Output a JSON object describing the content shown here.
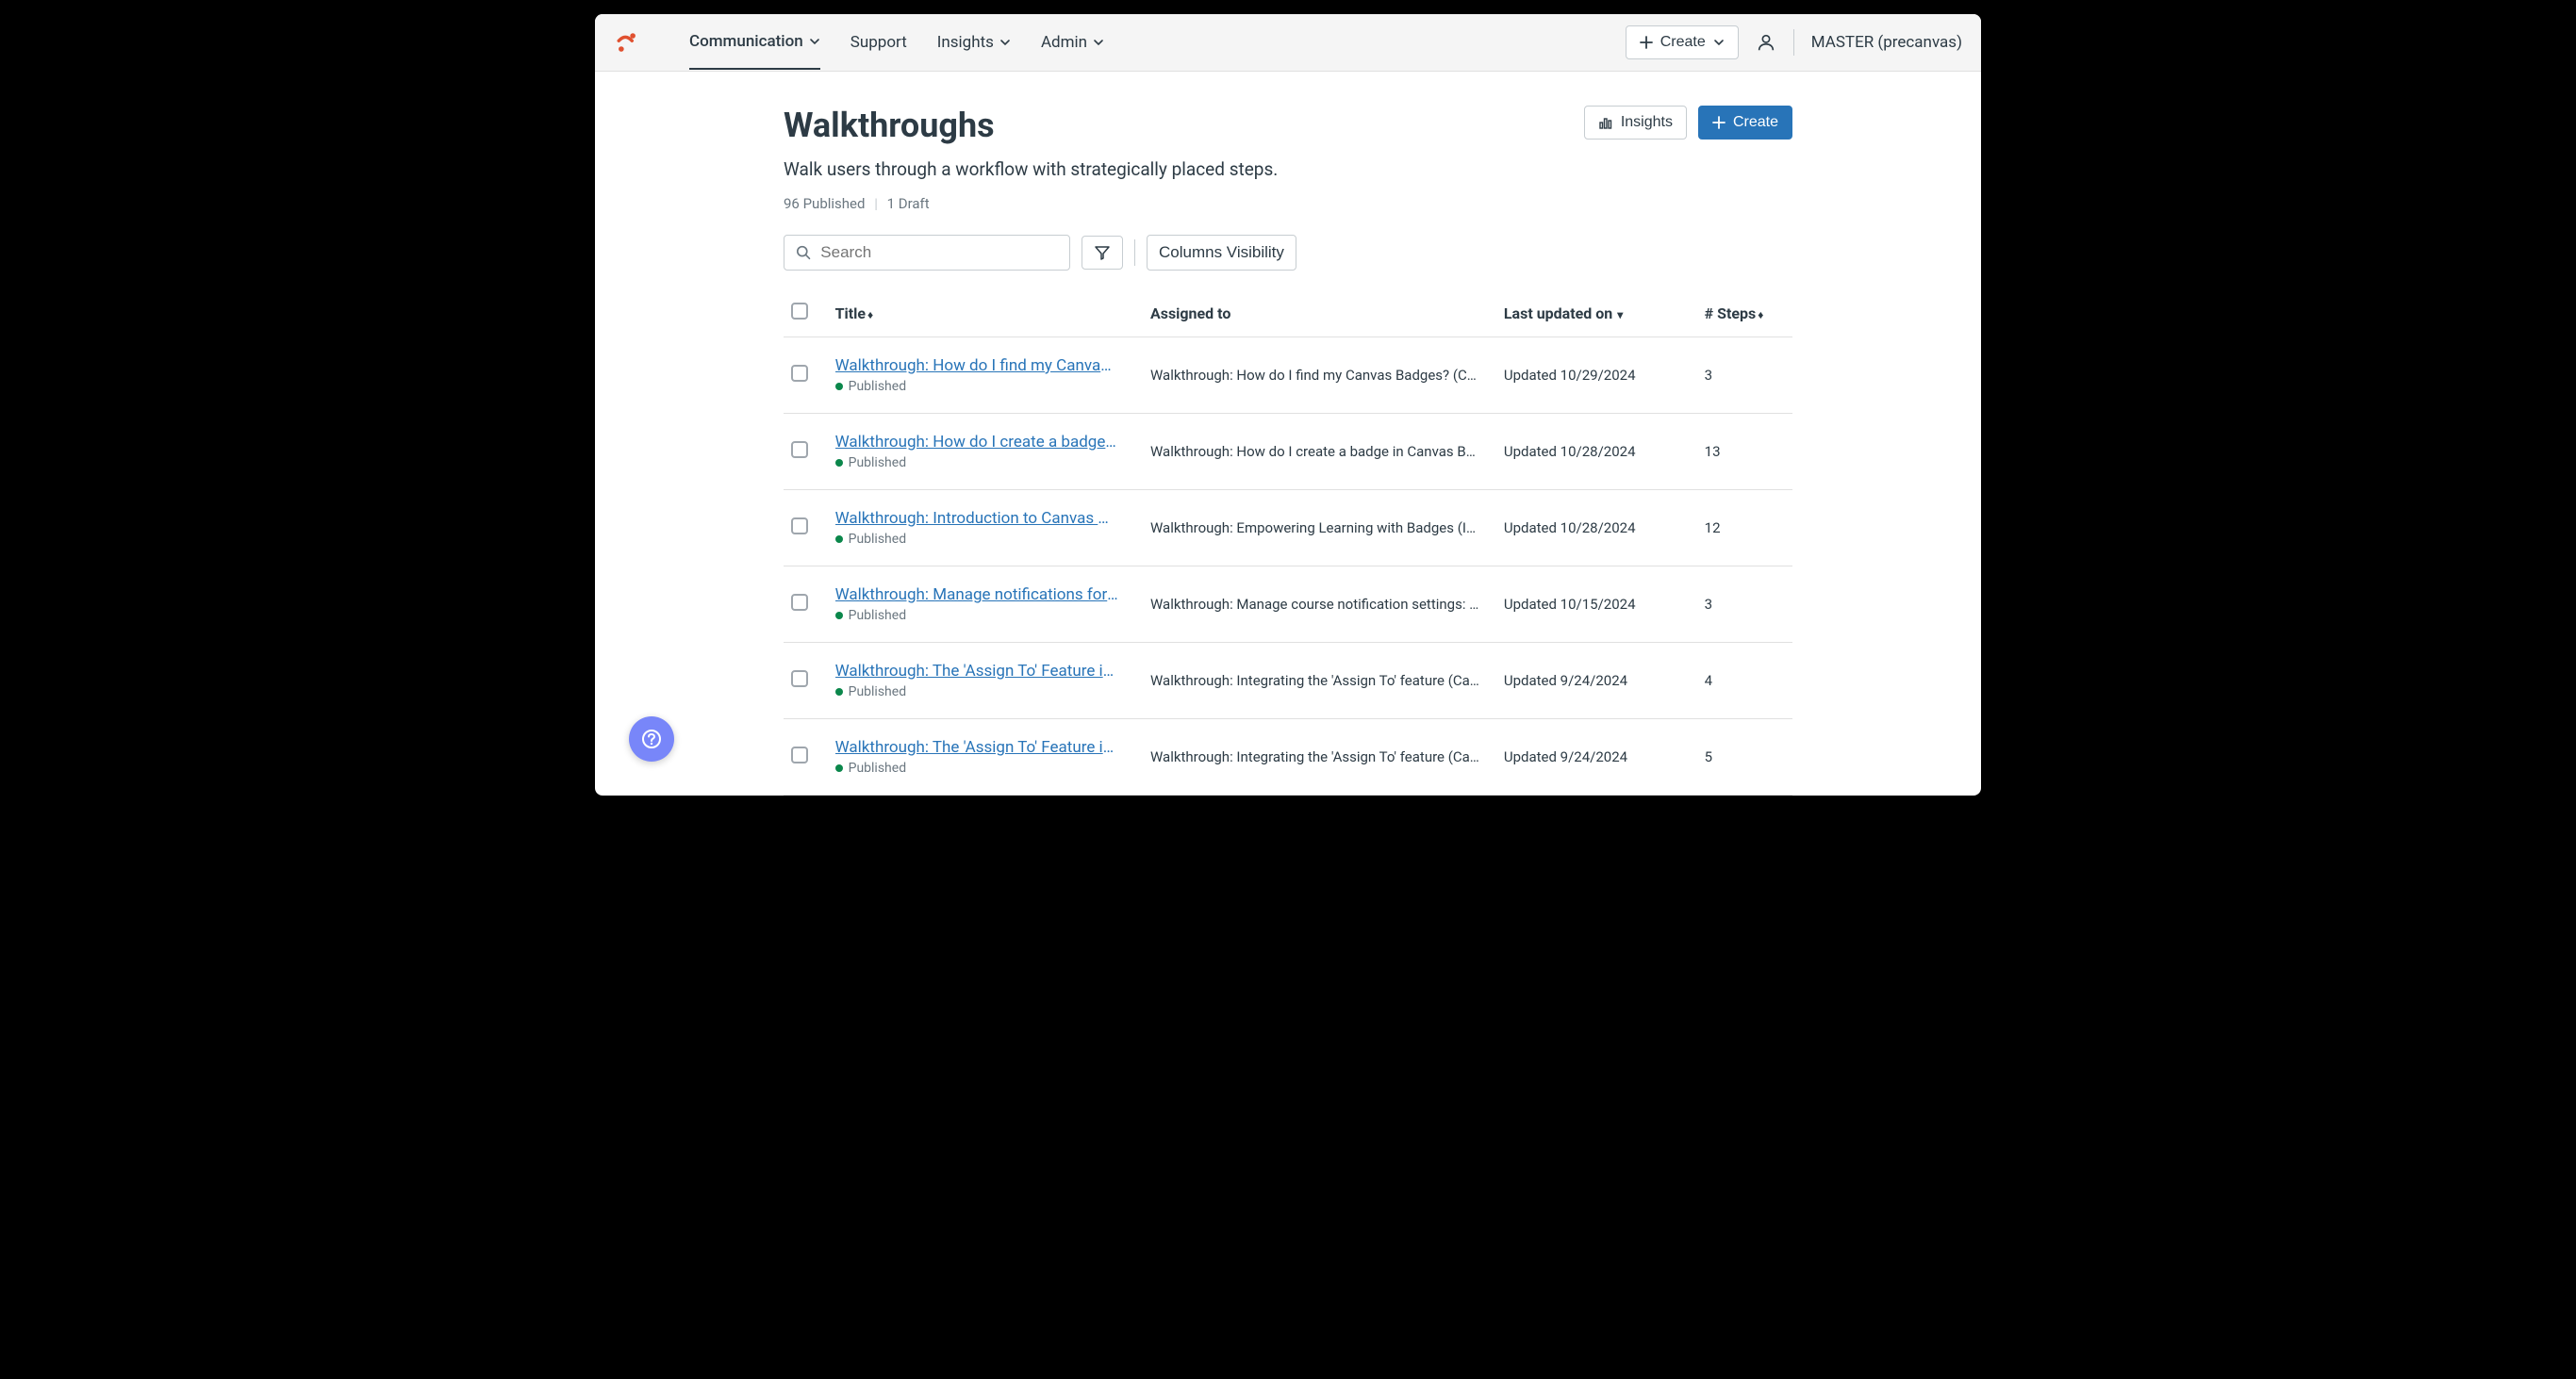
{
  "nav": {
    "items": [
      "Communication",
      "Support",
      "Insights",
      "Admin"
    ],
    "dropdown": [
      true,
      false,
      true,
      true
    ],
    "active_index": 0
  },
  "topbar": {
    "create_label": "Create",
    "username": "MASTER (precanvas)"
  },
  "page": {
    "title": "Walkthroughs",
    "subtitle": "Walk users through a workflow with strategically placed steps.",
    "published_count": "96 Published",
    "draft_count": "1 Draft",
    "insights_label": "Insights",
    "create_label": "Create"
  },
  "toolbar": {
    "search_placeholder": "Search",
    "columns_label": "Columns Visibility"
  },
  "table": {
    "headers": {
      "title": "Title",
      "assigned": "Assigned to",
      "updated": "Last updated on",
      "steps": "# Steps"
    },
    "published_label": "Published",
    "rows": [
      {
        "title": "Walkthrough: How do I find my Canvas Ba…",
        "assigned": "Walkthrough: How do I find my Canvas Badges? (Campaign)",
        "updated": "Updated 10/29/2024",
        "steps": "3"
      },
      {
        "title": "Walkthrough: How do I create a badge in …",
        "assigned": "Walkthrough: How do I create a badge in Canvas Badges? (Campaign)",
        "updated": "Updated 10/28/2024",
        "steps": "13"
      },
      {
        "title": "Walkthrough: Introduction to Canvas Cre…",
        "assigned": "Walkthrough: Empowering Learning with Badges (Instru... (Campaign)",
        "updated": "Updated 10/28/2024",
        "steps": "12"
      },
      {
        "title": "Walkthrough: Manage notifications for a s…",
        "assigned": "Walkthrough: Manage course notification settings: St... (Campaign)",
        "updated": "Updated 10/15/2024",
        "steps": "3"
      },
      {
        "title": "Walkthrough: The 'Assign To' Feature in P…",
        "assigned": "Walkthrough: Integrating the 'Assign To' feature (Campaign)",
        "updated": "Updated 9/24/2024",
        "steps": "4"
      },
      {
        "title": "Walkthrough: The 'Assign To' Feature in A…",
        "assigned": "Walkthrough: Integrating the 'Assign To' feature (Campaign)",
        "updated": "Updated 9/24/2024",
        "steps": "5"
      }
    ]
  }
}
